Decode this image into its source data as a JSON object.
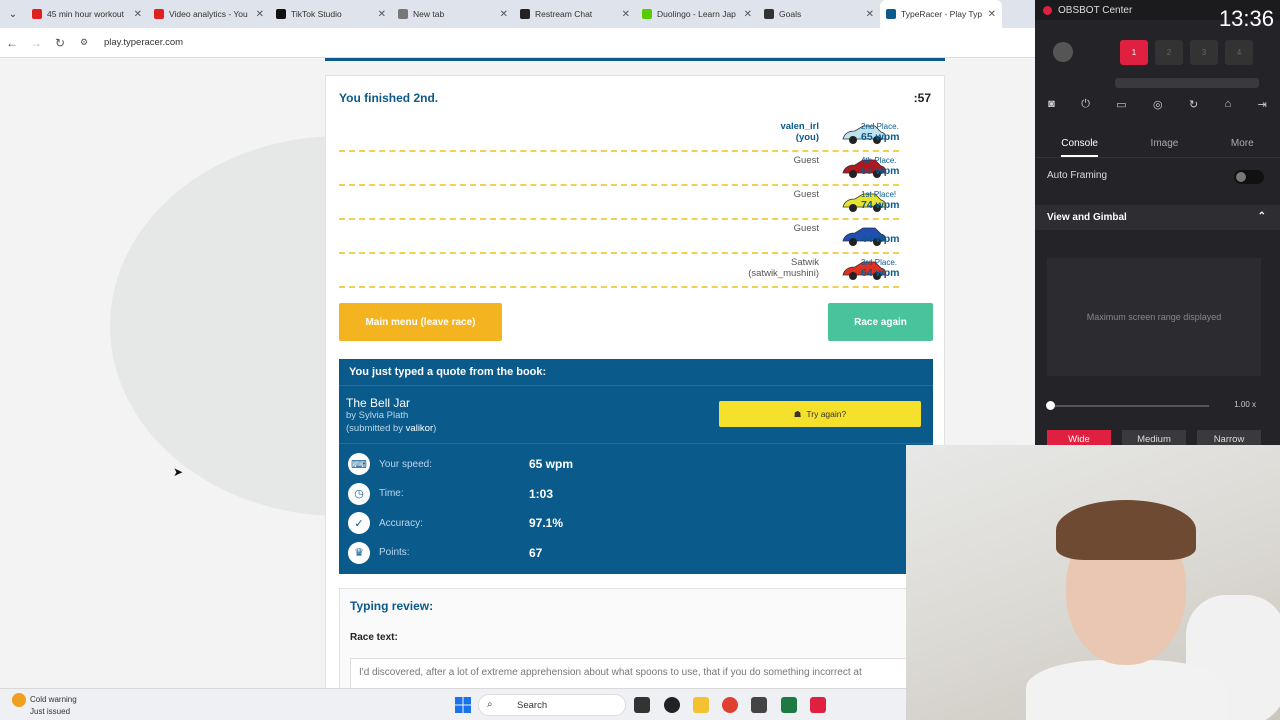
{
  "browser": {
    "tabs": [
      {
        "title": "45 min hour workout",
        "color": "#e02020"
      },
      {
        "title": "Video analytics - You",
        "color": "#e02020"
      },
      {
        "title": "TikTok Studio",
        "color": "#111111"
      },
      {
        "title": "New tab",
        "color": "#777777"
      },
      {
        "title": "Restream Chat",
        "color": "#222222"
      },
      {
        "title": "Duolingo - Learn Jap",
        "color": "#58cc02"
      },
      {
        "title": "Goals",
        "color": "#333333"
      },
      {
        "title": "TypeRacer - Play Typ",
        "color": "#0b5a8c"
      }
    ],
    "url": "play.typeracer.com"
  },
  "race": {
    "finished": "You finished 2nd.",
    "timer": ":57",
    "lanes": [
      {
        "name": "valen_irl",
        "sub": "(you)",
        "place": "2nd Place.",
        "wpm": "65 wpm",
        "car": "#bfe3ee",
        "you": true
      },
      {
        "name": "Guest",
        "sub": "",
        "place": "4th Place.",
        "wpm": "57 wpm",
        "car": "#b01820"
      },
      {
        "name": "Guest",
        "sub": "",
        "place": "1st Place!",
        "wpm": "74 wpm",
        "car": "#e8e230"
      },
      {
        "name": "Guest",
        "sub": "",
        "place": "",
        "wpm": "44 wpm",
        "car": "#1f4fb0"
      },
      {
        "name": "Satwik",
        "sub": "(satwik_mushini)",
        "place": "3rd Place.",
        "wpm": "64 wpm",
        "car": "#e03020"
      }
    ],
    "main_menu": "Main menu (leave race)",
    "race_again": "Race again"
  },
  "quote": {
    "header": "You just typed a quote from the book:",
    "book": "The Bell Jar",
    "author": "by Sylvia Plath",
    "submitted_prefix": "(submitted by ",
    "submitter": "valikor",
    "submitted_suffix": ")",
    "try_again": "Try again?",
    "stats": [
      {
        "label": "Your speed:",
        "value": "65 wpm",
        "icon": "keyboard-icon",
        "glyph": "⌨"
      },
      {
        "label": "Time:",
        "value": "1:03",
        "icon": "clock-icon",
        "glyph": "◷"
      },
      {
        "label": "Accuracy:",
        "value": "97.1%",
        "icon": "check-icon",
        "glyph": "✓"
      },
      {
        "label": "Points:",
        "value": "67",
        "icon": "trophy-icon",
        "glyph": "♛"
      }
    ]
  },
  "review": {
    "title": "Typing review:",
    "label": "Race text:",
    "text": "I'd discovered, after a lot of extreme apprehension about what spoons to use, that if you do something incorrect at"
  },
  "obsbot": {
    "title": "OBSBOT Center",
    "clock": "13:36",
    "slots": [
      "1",
      "2",
      "3",
      "4"
    ],
    "tabs": [
      "Console",
      "Image",
      "More"
    ],
    "auto_framing": "Auto Framing",
    "view_gimbal": "View and Gimbal",
    "range": "Maximum screen range displayed",
    "zoom": "1.00 x",
    "modes": [
      "Wide",
      "Medium",
      "Narrow"
    ]
  },
  "taskbar": {
    "weather_title": "Cold warning",
    "weather_sub": "Just issued",
    "search": "Search"
  }
}
